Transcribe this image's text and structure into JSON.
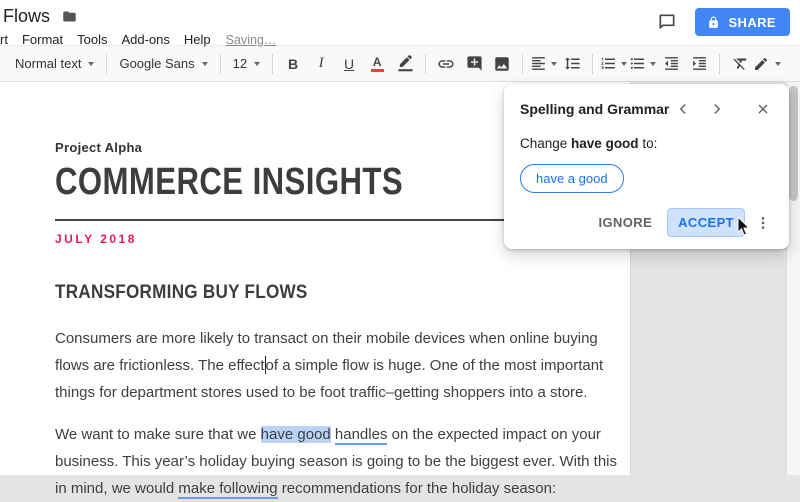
{
  "titlebar": {
    "doc_title": "Flows",
    "menus": [
      "rt",
      "Format",
      "Tools",
      "Add-ons",
      "Help"
    ],
    "saving_status": "Saving…",
    "share_label": "SHARE"
  },
  "toolbar": {
    "style_dropdown": "Normal text",
    "font_dropdown": "Google Sans",
    "font_size": "12",
    "icons": {
      "bold": "B",
      "italic": "I",
      "underline": "U",
      "text_color": "A"
    }
  },
  "document": {
    "kicker": "Project Alpha",
    "title": "COMMERCE INSIGHTS",
    "date": "JULY 2018",
    "heading": "TRANSFORMING BUY FLOWS",
    "para1_segments": [
      {
        "text": "Consumers are more likely to transact on their mobile devices when online buying flows are frictionless. The effect",
        "style": "normal",
        "name": "text-segment"
      },
      {
        "text": "",
        "style": "caret",
        "name": "text-cursor"
      },
      {
        "text": "of a simple flow is huge. One of the most important things for department stores used to be foot traffic–getting shoppers into a store.",
        "style": "normal",
        "name": "text-segment"
      }
    ],
    "para2_segments": [
      {
        "text": "We want to make sure that we ",
        "style": "normal",
        "name": "text-segment"
      },
      {
        "text": "have good",
        "style": "selection",
        "name": "flagged-phrase-active",
        "interactable": true
      },
      {
        "text": " ",
        "style": "normal",
        "name": "text-segment"
      },
      {
        "text": "handles",
        "style": "grammar",
        "name": "flagged-phrase",
        "interactable": true
      },
      {
        "text": " on the expected impact on your business. This year’s holiday buying season is going to be the biggest ever. With this in mind, we would ",
        "style": "normal",
        "name": "text-segment"
      },
      {
        "text": "make following",
        "style": "grammar",
        "name": "flagged-phrase",
        "interactable": true
      },
      {
        "text": " recommendations for the holiday season:",
        "style": "normal",
        "name": "text-segment"
      }
    ]
  },
  "popup": {
    "title": "Spelling and Grammar",
    "change_prefix": "Change ",
    "change_phrase": "have good",
    "change_suffix": " to:",
    "suggestion": "have a good",
    "ignore_label": "IGNORE",
    "accept_label": "ACCEPT"
  },
  "colors": {
    "share_button_blue": "#4285f4",
    "suggestion_blue": "#1a73e8",
    "selection_highlight": "#b9d3f8",
    "grammar_underline": "#6b9bf2",
    "date_red": "#e8185c",
    "accept_background": "#cfe1fb"
  }
}
